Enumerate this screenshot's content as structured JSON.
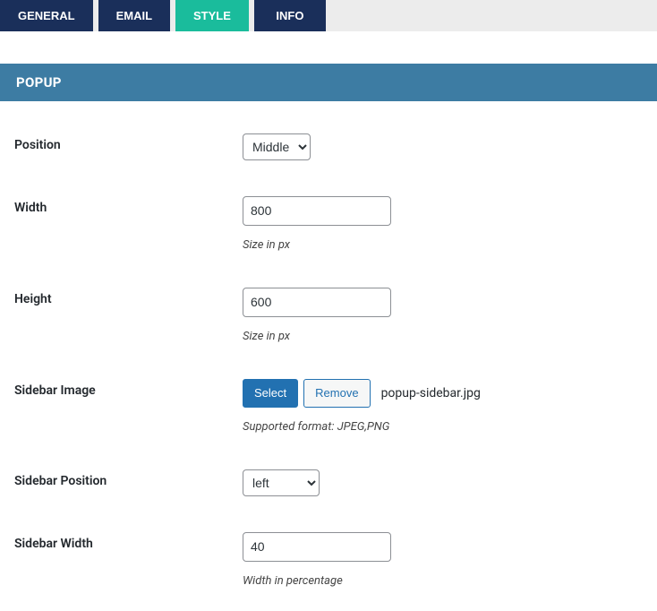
{
  "tabs": {
    "general": "GENERAL",
    "email": "EMAIL",
    "style": "STYLE",
    "info": "INFO"
  },
  "section": {
    "popup": "POPUP"
  },
  "fields": {
    "position": {
      "label": "Position",
      "value": "Middle"
    },
    "width": {
      "label": "Width",
      "value": "800",
      "help": "Size in px"
    },
    "height": {
      "label": "Height",
      "value": "600",
      "help": "Size in px"
    },
    "sidebar_image": {
      "label": "Sidebar Image",
      "select_btn": "Select",
      "remove_btn": "Remove",
      "filename": "popup-sidebar.jpg",
      "help": "Supported format: JPEG,PNG"
    },
    "sidebar_position": {
      "label": "Sidebar Position",
      "value": "left"
    },
    "sidebar_width": {
      "label": "Sidebar Width",
      "value": "40",
      "help": "Width in percentage"
    }
  }
}
